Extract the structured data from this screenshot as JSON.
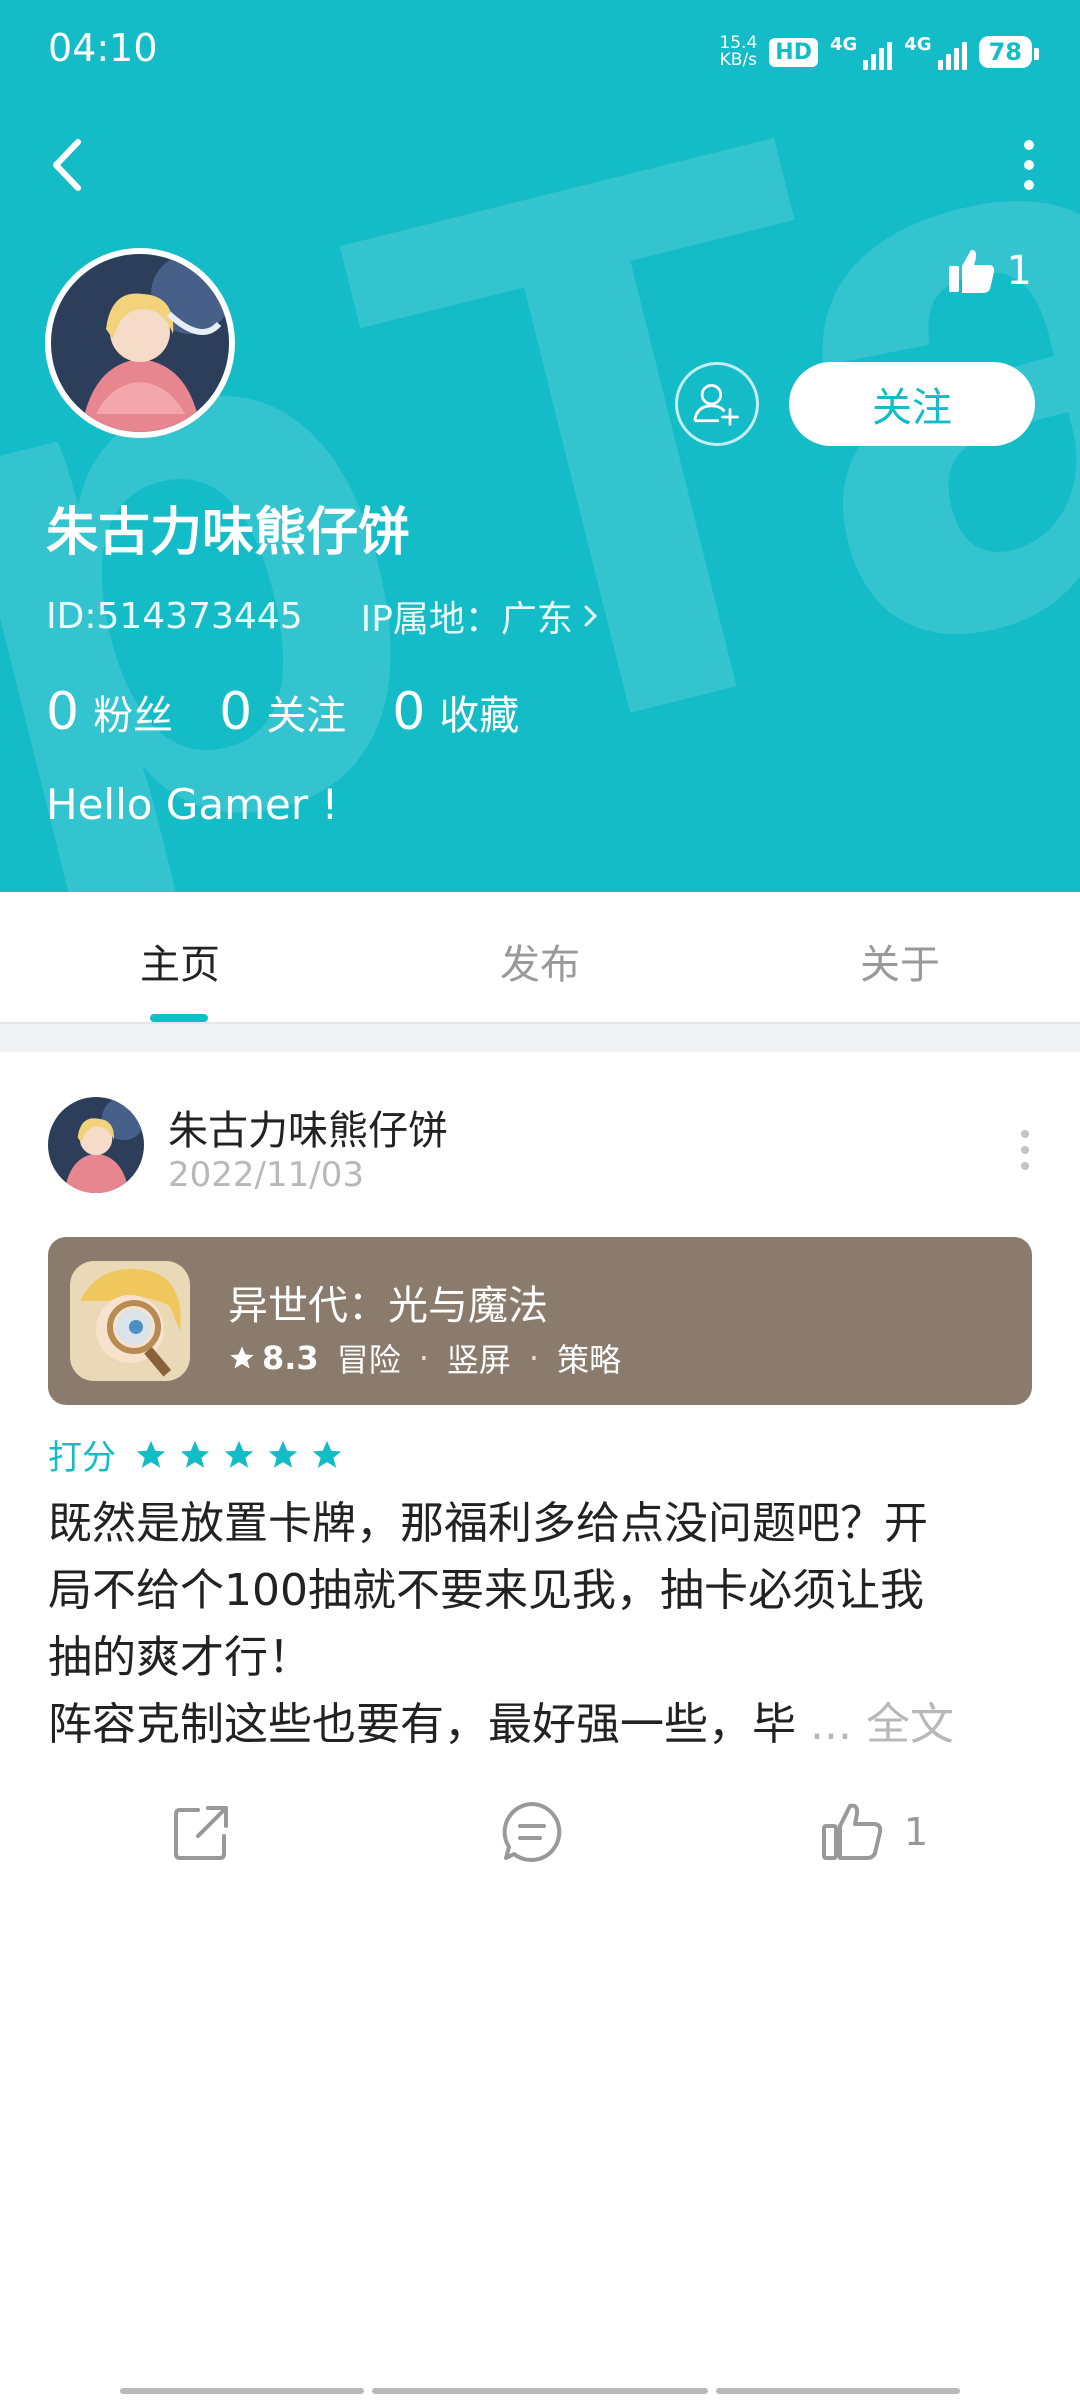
{
  "status_bar": {
    "time": "04:10",
    "net_speed_top": "15.4",
    "net_speed_bottom": "KB/s",
    "hd_label": "HD",
    "signal1_label": "4G",
    "signal2_label": "4G",
    "battery": "78"
  },
  "profile": {
    "likes": "1",
    "follow_label": "关注",
    "nickname": "朱古力味熊仔饼",
    "id_text": "ID:514373445",
    "ip_text": "IP属地：广东",
    "stats": [
      {
        "num": "0",
        "label": "粉丝"
      },
      {
        "num": "0",
        "label": "关注"
      },
      {
        "num": "0",
        "label": "收藏"
      }
    ],
    "bio": "Hello Gamer !"
  },
  "tabs": [
    "主页",
    "发布",
    "关于"
  ],
  "post": {
    "author": "朱古力味熊仔饼",
    "date": "2022/11/03",
    "game": {
      "name": "异世代：光与魔法",
      "score": "8.3",
      "tags": [
        "冒险",
        "竖屏",
        "策略"
      ]
    },
    "rating_label": "打分",
    "rating_stars": 5,
    "body_lines": [
      "既然是放置卡牌，那福利多给点没问题吧？开",
      "局不给个100抽就不要来见我，抽卡必须让我",
      "抽的爽才行！",
      "阵容克制这些也要有，最好强一些，毕"
    ],
    "read_more": "... 全文",
    "like_count": "1"
  },
  "colors": {
    "accent": "#14bcc8",
    "game_card_bg": "#8b7b6d",
    "muted_text": "#b8b8b8"
  }
}
